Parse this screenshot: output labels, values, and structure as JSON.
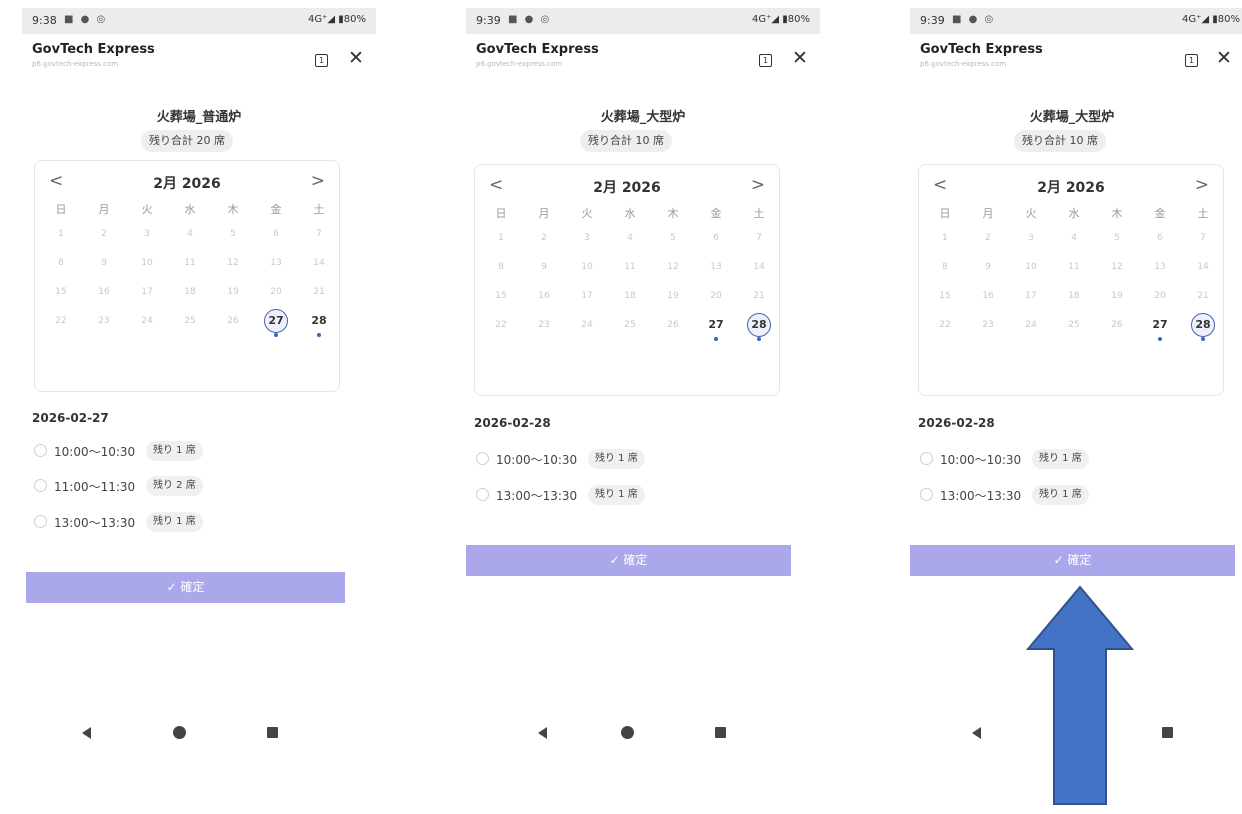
{
  "app": {
    "title": "GovTech Express",
    "url": "p6.govtech-express.com",
    "tab_count": "1",
    "close_symbol": "✕"
  },
  "calendar_labels": {
    "prev": "<",
    "next": ">",
    "month": "2月 2026",
    "weekdays": [
      "日",
      "月",
      "火",
      "水",
      "木",
      "金",
      "土"
    ]
  },
  "confirm_label": "✓ 確定",
  "screens": [
    {
      "status": {
        "time": "9:38",
        "left_icons": "■ ● ◎",
        "right_icons": "4G⁺◢ ▮80%"
      },
      "facility": "火葬場_普通炉",
      "remaining_total": "残り合計 20 席",
      "selected_date": "2026-02-27",
      "slots": [
        {
          "time": "10:00〜10:30",
          "remaining": "残り 1 席"
        },
        {
          "time": "11:00〜11:30",
          "remaining": "残り 2 席"
        },
        {
          "time": "13:00〜13:30",
          "remaining": "残り 1 席"
        }
      ]
    },
    {
      "status": {
        "time": "9:39",
        "left_icons": "■ ● ◎",
        "right_icons": "4G⁺◢ ▮80%"
      },
      "facility": "火葬場_大型炉",
      "remaining_total": "残り合計 10 席",
      "selected_date": "2026-02-28",
      "slots": [
        {
          "time": "10:00〜10:30",
          "remaining": "残り 1 席"
        },
        {
          "time": "13:00〜13:30",
          "remaining": "残り 1 席"
        }
      ]
    },
    {
      "status": {
        "time": "9:39",
        "left_icons": "■ ● ◎",
        "right_icons": "4G⁺◢ ▮80%"
      },
      "facility": "火葬場_大型炉",
      "remaining_total": "残り合計 10 席",
      "selected_date": "2026-02-28",
      "slots": [
        {
          "time": "10:00〜10:30",
          "remaining": "残り 1 席"
        },
        {
          "time": "13:00〜13:30",
          "remaining": "残り 1 席"
        }
      ]
    }
  ],
  "colors": {
    "accent": "#aaa8eb",
    "selected_ring": "#4a5fb0",
    "availability_dot": "#3f63c7",
    "annotation_arrow": "#4472c4"
  }
}
